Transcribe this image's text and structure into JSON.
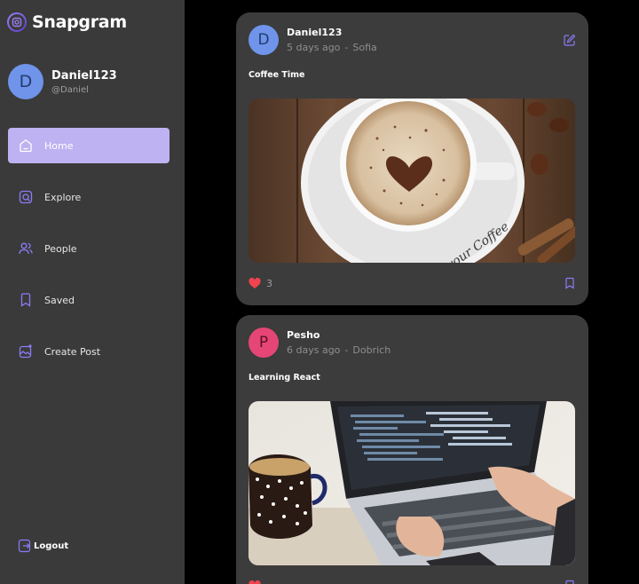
{
  "brand": {
    "name": "Snapgram"
  },
  "user": {
    "initial": "D",
    "name": "Daniel123",
    "handle": "@Daniel"
  },
  "nav": [
    {
      "label": "Home",
      "icon": "home-icon",
      "active": true
    },
    {
      "label": "Explore",
      "icon": "explore-icon",
      "active": false
    },
    {
      "label": "People",
      "icon": "people-icon",
      "active": false
    },
    {
      "label": "Saved",
      "icon": "bookmark-icon",
      "active": false
    },
    {
      "label": "Create Post",
      "icon": "create-post-icon",
      "active": false
    }
  ],
  "logout_label": "Logout",
  "posts": [
    {
      "initial": "D",
      "author": "Daniel123",
      "time": "5 days ago",
      "location": "Sofia",
      "caption": "Coffee Time",
      "image": "coffee-latte-art-photo",
      "likes": "3"
    },
    {
      "initial": "P",
      "author": "Pesho",
      "time": "6 days ago",
      "location": "Dobrich",
      "caption": "Learning React",
      "image": "laptop-coding-photo"
    }
  ],
  "colors": {
    "sidebar_bg": "#3a3a3a",
    "card_bg": "#3c3c3c",
    "accent": "#bfb2f2",
    "icon_purple": "#8b7cf6",
    "like_red": "#f0434f"
  }
}
